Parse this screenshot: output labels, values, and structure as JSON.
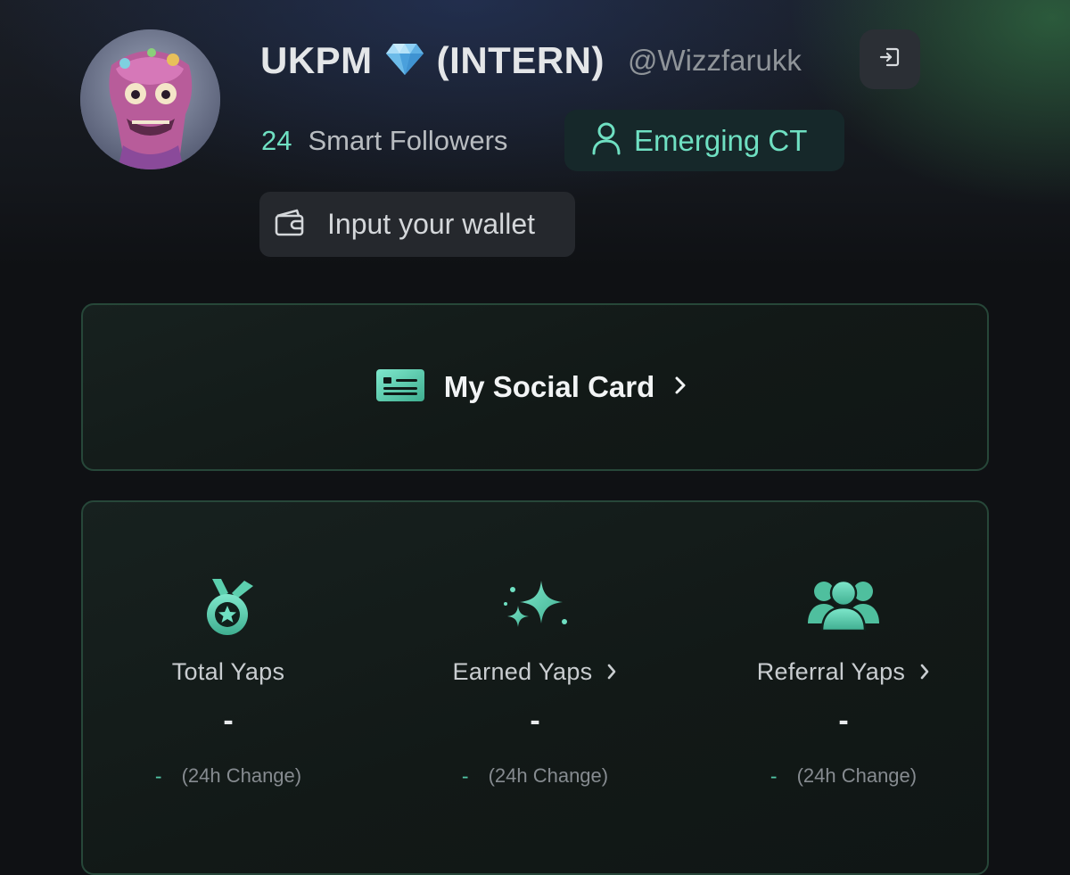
{
  "profile": {
    "display_name_prefix": "UKPM",
    "display_name_suffix": "(INTERN)",
    "handle": "@Wizzfarukk",
    "smart_followers_count": "24",
    "smart_followers_label": "Smart Followers",
    "tier_badge": "Emerging CT",
    "wallet_button_label": "Input your wallet"
  },
  "social_card": {
    "label": "My Social Card"
  },
  "yaps": [
    {
      "title": "Total Yaps",
      "value": "-",
      "change_value": "-",
      "change_label": "(24h Change)",
      "has_chevron": false,
      "icon": "medal-icon"
    },
    {
      "title": "Earned Yaps",
      "value": "-",
      "change_value": "-",
      "change_label": "(24h Change)",
      "has_chevron": true,
      "icon": "sparkles-icon"
    },
    {
      "title": "Referral Yaps",
      "value": "-",
      "change_value": "-",
      "change_label": "(24h Change)",
      "has_chevron": true,
      "icon": "users-icon"
    }
  ],
  "colors": {
    "accent": "#6fe0c2",
    "background": "#0f1114",
    "card_border": "#274739"
  }
}
